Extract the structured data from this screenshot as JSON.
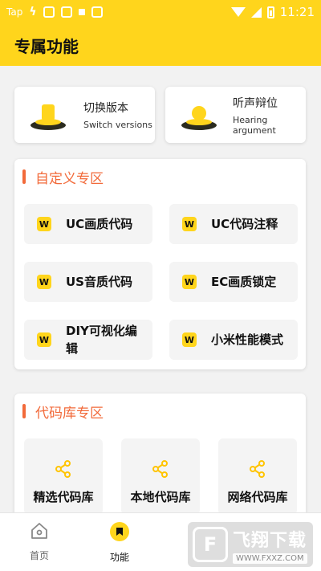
{
  "status_bar": {
    "carrier": "Tap",
    "time": "11:21"
  },
  "header": {
    "title": "专属功能"
  },
  "top_cards": [
    {
      "zh": "切换版本",
      "en": "Switch versions"
    },
    {
      "zh": "听声辩位",
      "en": "Hearing argument"
    }
  ],
  "custom_section": {
    "title": "自定义专区",
    "icon_letter": "W",
    "items": [
      {
        "label": "UC画质代码"
      },
      {
        "label": "UC代码注释"
      },
      {
        "label": "US音质代码"
      },
      {
        "label": "EC画质锁定"
      },
      {
        "label": "DIY可视化编辑"
      },
      {
        "label": "小米性能模式"
      }
    ]
  },
  "library_section": {
    "title": "代码库专区",
    "items": [
      {
        "label": "精选代码库"
      },
      {
        "label": "本地代码库"
      },
      {
        "label": "网络代码库"
      }
    ]
  },
  "bottom_nav": {
    "items": [
      {
        "label": "首页",
        "icon": "home-icon"
      },
      {
        "label": "功能",
        "icon": "function-icon"
      }
    ]
  },
  "watermark": {
    "brand": "飞翔下载",
    "url": "WWW.FXXZ.COM"
  },
  "colors": {
    "accent": "#ffd51c",
    "section_title": "#f26a3a"
  }
}
